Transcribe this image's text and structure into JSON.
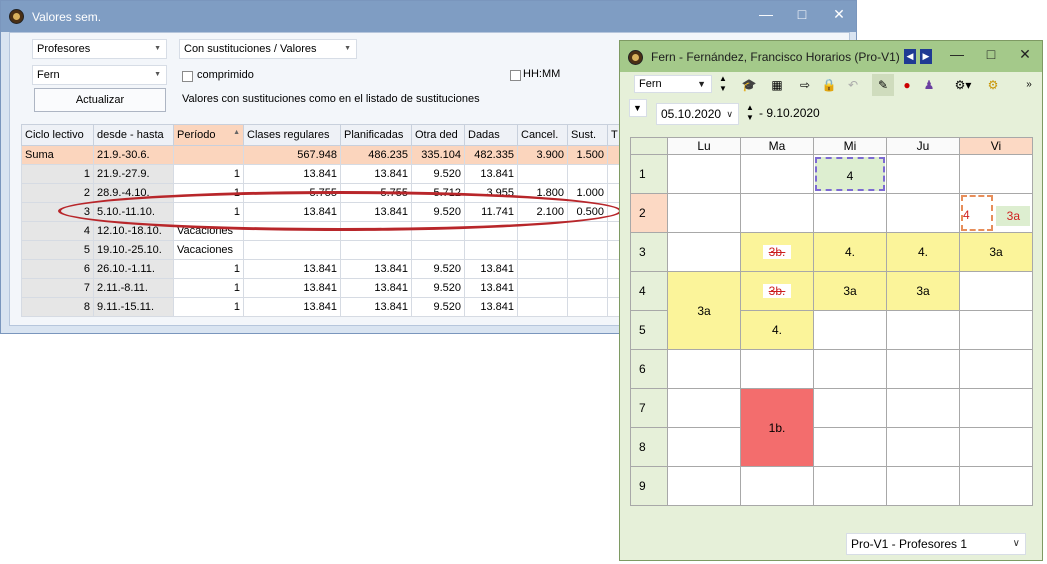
{
  "window1": {
    "title": "Valores sem.",
    "combo_profesores": "Profesores",
    "combo_fern": "Fern",
    "combo_mode": "Con sustituciones / Valores",
    "comprimido_label": "comprimido",
    "hhmm_label": "HH:MM",
    "actualizar_label": "Actualizar",
    "info_text": "Valores con sustituciones como en el listado de sustituciones",
    "columns": [
      "Ciclo lectivo",
      "desde - hasta",
      "Período",
      "Clases regulares",
      "Planificadas",
      "Otra ded",
      "Dadas",
      "Cancel.",
      "Sust.",
      "T"
    ],
    "rows": [
      [
        "Suma",
        "21.9.-30.6.",
        "",
        "567.948",
        "486.235",
        "335.104",
        "482.335",
        "3.900",
        "1.500",
        ""
      ],
      [
        "1",
        "21.9.-27.9.",
        "1",
        "13.841",
        "13.841",
        "9.520",
        "13.841",
        "",
        "",
        ""
      ],
      [
        "2",
        "28.9.-4.10.",
        "1",
        "5.755",
        "5.755",
        "5.712",
        "3.955",
        "1.800",
        "1.000",
        ""
      ],
      [
        "3",
        "5.10.-11.10.",
        "1",
        "13.841",
        "13.841",
        "9.520",
        "11.741",
        "2.100",
        "0.500",
        ""
      ],
      [
        "4",
        "12.10.-18.10.",
        "Vacaciones",
        "",
        "",
        "",
        "",
        "",
        "",
        ""
      ],
      [
        "5",
        "19.10.-25.10.",
        "Vacaciones",
        "",
        "",
        "",
        "",
        "",
        "",
        ""
      ],
      [
        "6",
        "26.10.-1.11.",
        "1",
        "13.841",
        "13.841",
        "9.520",
        "13.841",
        "",
        "",
        ""
      ],
      [
        "7",
        "2.11.-8.11.",
        "1",
        "13.841",
        "13.841",
        "9.520",
        "13.841",
        "",
        "",
        ""
      ],
      [
        "8",
        "9.11.-15.11.",
        "1",
        "13.841",
        "13.841",
        "9.520",
        "13.841",
        "",
        "",
        ""
      ]
    ]
  },
  "window2": {
    "title": "Fern - Fernández, Francisco  Horarios  (Pro-V1)",
    "combo_fern": "Fern",
    "date_from": "05.10.2020",
    "date_to": "- 9.10.2020",
    "days": [
      "Lu",
      "Ma",
      "Mi",
      "Ju",
      "Vi"
    ],
    "hours": [
      "1",
      "2",
      "3",
      "4",
      "5",
      "6",
      "7",
      "8",
      "9"
    ],
    "cells": {
      "mi1": "4",
      "vi2a": "4",
      "vi2b": "3a",
      "ma3": "3b.",
      "mi3": "4.",
      "ju3": "4.",
      "vi3": "3a",
      "ma4": "3b.",
      "mi4": "3a",
      "ju4": "3a",
      "lu45": "3a",
      "ma5": "4.",
      "ma78": "1b."
    },
    "footer_combo": "Pro-V1 - Profesores 1"
  }
}
